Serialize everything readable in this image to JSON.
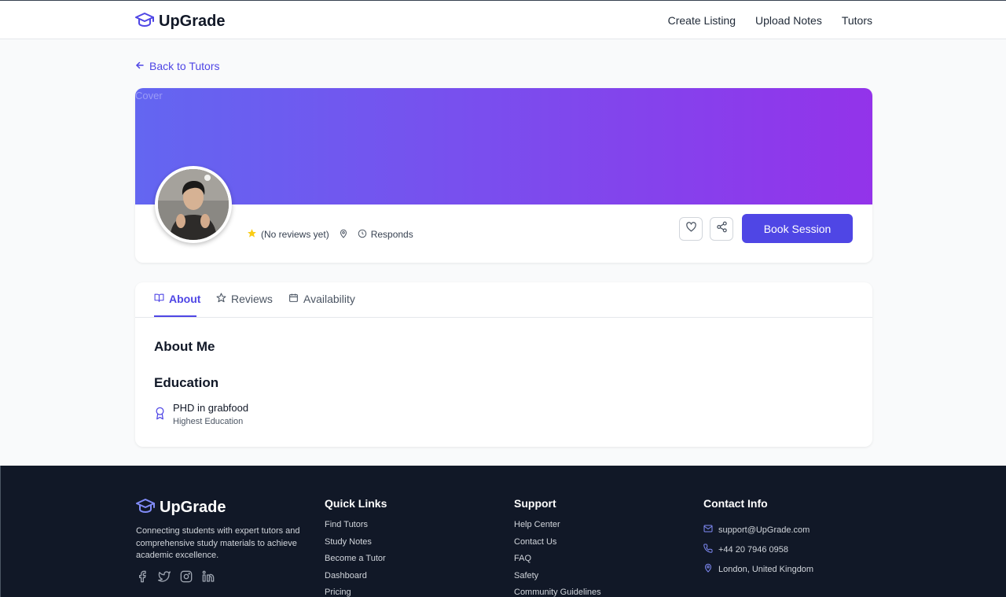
{
  "brand": {
    "name": "UpGrade",
    "icon": "graduation-cap-icon"
  },
  "nav": {
    "items": [
      "Create Listing",
      "Upload Notes",
      "Tutors"
    ]
  },
  "back_link": {
    "label": "Back to Tutors"
  },
  "profile": {
    "cover_alt": "Cover",
    "rating_text": "(No reviews yet)",
    "responds_text": "Responds",
    "book_label": "Book Session"
  },
  "tabs": [
    {
      "label": "About",
      "icon": "book-icon",
      "active": true
    },
    {
      "label": "Reviews",
      "icon": "star-icon",
      "active": false
    },
    {
      "label": "Availability",
      "icon": "calendar-icon",
      "active": false
    }
  ],
  "about": {
    "heading": "About Me",
    "education_heading": "Education",
    "education": {
      "title": "PHD in grabfood",
      "subtitle": "Highest Education"
    }
  },
  "footer": {
    "brand_name": "UpGrade",
    "description": "Connecting students with expert tutors and comprehensive study materials to achieve academic excellence.",
    "social": [
      "facebook-icon",
      "twitter-icon",
      "instagram-icon",
      "linkedin-icon"
    ],
    "quick_links": {
      "heading": "Quick Links",
      "items": [
        "Find Tutors",
        "Study Notes",
        "Become a Tutor",
        "Dashboard",
        "Pricing"
      ]
    },
    "support": {
      "heading": "Support",
      "items": [
        "Help Center",
        "Contact Us",
        "FAQ",
        "Safety",
        "Community Guidelines"
      ]
    },
    "contact": {
      "heading": "Contact Info",
      "email": "support@UpGrade.com",
      "phone": "+44 20 7946 0958",
      "location": "London, United Kingdom"
    }
  },
  "colors": {
    "accent": "#4f46e5",
    "cover_start": "#6366f1",
    "cover_end": "#9333ea",
    "footer_bg": "#111827",
    "star": "#facc15"
  }
}
